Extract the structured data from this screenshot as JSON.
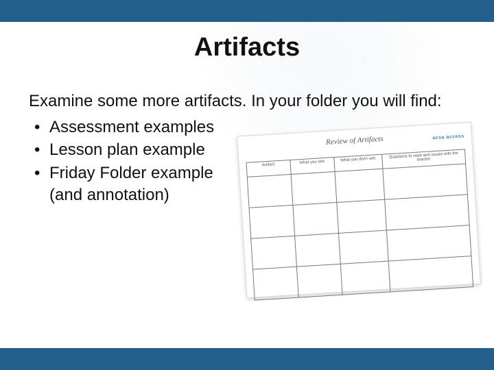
{
  "title": "Artifacts",
  "intro": "Examine some more artifacts. In your folder you will find:",
  "bullets": [
    "Assessment examples",
    "Lesson plan example",
    "Friday Folder example (and annotation)"
  ],
  "worksheet": {
    "title": "Review of Artifacts",
    "logo": "acsa access",
    "columns": [
      "Artifact",
      "What you see",
      "What you don't see",
      "Questions to raise and issues with the teacher"
    ]
  },
  "colors": {
    "bar": "#245f8a",
    "text": "#111111",
    "background": "#ffffff"
  }
}
